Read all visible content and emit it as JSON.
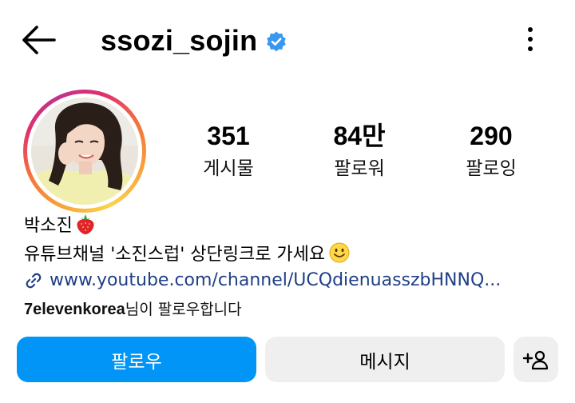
{
  "header": {
    "username": "ssozi_sojin",
    "back_icon": "arrow-left-icon",
    "verified_icon": "verified-badge-icon",
    "more_icon": "more-vertical-icon"
  },
  "stats": {
    "posts": {
      "value": "351",
      "label": "게시물"
    },
    "followers": {
      "value": "84만",
      "label": "팔로워"
    },
    "following": {
      "value": "290",
      "label": "팔로잉"
    }
  },
  "bio": {
    "name": "박소진",
    "name_emoji": "strawberry-icon",
    "text": "유튜브채널 '소진스럽' 상단링크로 가세요",
    "text_emoji": "smiling-face-icon",
    "link": "www.youtube.com/channel/UCQdienuasszbHNNQ...",
    "link_icon": "link-icon",
    "followed_by_user": "7elevenkorea",
    "followed_by_suffix": "님이 팔로우합니다"
  },
  "actions": {
    "follow_label": "팔로우",
    "message_label": "메시지",
    "add_user_icon": "add-user-icon"
  },
  "colors": {
    "primary_button": "#0095f6",
    "secondary_button": "#efefef",
    "link": "#1f3f86",
    "verified": "#3897f0"
  }
}
